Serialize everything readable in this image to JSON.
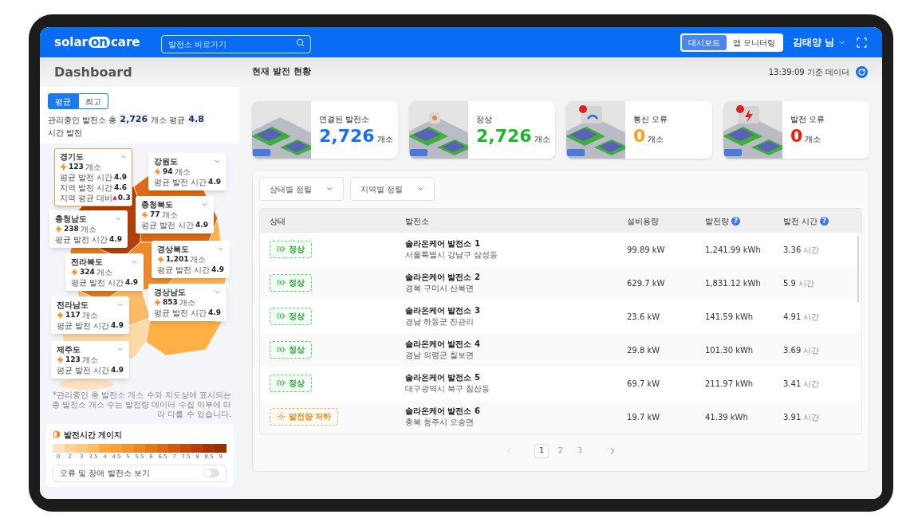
{
  "header": {
    "logo": [
      "solar",
      "on",
      "care"
    ],
    "search": {
      "placeholder": "발전소 바로가기"
    },
    "view_tabs": [
      {
        "label": "대시보드",
        "selected": true
      },
      {
        "label": "앱 모니터링",
        "selected": false
      }
    ],
    "user": "김태양 님"
  },
  "subheader": {
    "title": "Dashboard",
    "section": "현재 발전 현황",
    "timestamp": "13:39:09 기준 데이터"
  },
  "sidebar": {
    "mode_tabs": [
      {
        "label": "평균",
        "selected": true
      },
      {
        "label": "최고",
        "selected": false
      }
    ],
    "summary": [
      {
        "kind": "label",
        "text": "관리중인 발전소 총"
      },
      {
        "kind": "value",
        "text": "2,726"
      },
      {
        "kind": "label",
        "text": "개소 평균"
      },
      {
        "kind": "value",
        "text": "4.8"
      },
      {
        "kind": "label",
        "text": "시간 발전"
      }
    ],
    "regions": [
      {
        "name": "경기도",
        "expanded": true,
        "count": "123",
        "unit": "개소",
        "rows": [
          {
            "label": "평균 발전 시간",
            "value": "4.9"
          },
          {
            "label": "지역 발전 시간",
            "value": "4.6"
          },
          {
            "label": "지역 평균 대비",
            "value": "0.3",
            "marker": "▲"
          }
        ]
      },
      {
        "name": "강원도",
        "expanded": false,
        "count": "94",
        "unit": "개소",
        "rows": [
          {
            "label": "평균 발전 시간",
            "value": "4.9"
          }
        ]
      },
      {
        "name": "충청북도",
        "expanded": false,
        "count": "77",
        "unit": "개소",
        "rows": [
          {
            "label": "평균 발전 시간",
            "value": "4.9"
          }
        ]
      },
      {
        "name": "충청남도",
        "expanded": false,
        "count": "238",
        "unit": "개소",
        "rows": [
          {
            "label": "평균 발전 시간",
            "value": "4.9"
          }
        ]
      },
      {
        "name": "경상북도",
        "expanded": false,
        "count": "1,201",
        "unit": "개소",
        "rows": [
          {
            "label": "평균 발전 시간",
            "value": "4.9"
          }
        ]
      },
      {
        "name": "전라북도",
        "expanded": false,
        "count": "324",
        "unit": "개소",
        "rows": [
          {
            "label": "평균 발전 시간",
            "value": "4.9"
          }
        ]
      },
      {
        "name": "경상남도",
        "expanded": false,
        "count": "853",
        "unit": "개소",
        "rows": [
          {
            "label": "평균 발전 시간",
            "value": "4.9"
          }
        ]
      },
      {
        "name": "전라남도",
        "expanded": false,
        "count": "117",
        "unit": "개소",
        "rows": [
          {
            "label": "평균 발전 시간",
            "value": "4.9"
          }
        ]
      },
      {
        "name": "제주도",
        "expanded": false,
        "count": "123",
        "unit": "개소",
        "rows": [
          {
            "label": "평균 발전 시간",
            "value": "4.9"
          }
        ]
      }
    ],
    "note": "*관리중인 총 발전소 개소 수와 지도상에 표시되는 총 발전소 개소 수는 발전량 데이터 수집 여부에 따라 다를 수 있습니다.",
    "gauge": {
      "title": "발전시간 게이지",
      "steps": [
        {
          "label": "0",
          "color": "#fde2c0"
        },
        {
          "label": "2",
          "color": "#fcd3a0"
        },
        {
          "label": "3",
          "color": "#fdc888"
        },
        {
          "label": "3.5",
          "color": "#fdbb66"
        },
        {
          "label": "4",
          "color": "#fda838"
        },
        {
          "label": "4.5",
          "color": "#f8a03a"
        },
        {
          "label": "5",
          "color": "#f39430"
        },
        {
          "label": "5.5",
          "color": "#ed8626"
        },
        {
          "label": "6",
          "color": "#e6781c"
        },
        {
          "label": "6.5",
          "color": "#de6a14"
        },
        {
          "label": "7",
          "color": "#d2590f"
        },
        {
          "label": "7.5",
          "color": "#c44a0a"
        },
        {
          "label": "8",
          "color": "#b83d08"
        },
        {
          "label": "8.5",
          "color": "#a83406"
        },
        {
          "label": "9",
          "color": "#983004"
        }
      ]
    },
    "error_toggle": {
      "label": "오류 및 장애 발전소 보기",
      "on": false
    }
  },
  "cards": [
    {
      "label": "연결된 발전소",
      "value": "2,726",
      "unit": "개소",
      "color": "#1a6ef5"
    },
    {
      "label": "정상",
      "value": "2,726",
      "unit": "개소",
      "color": "#1db82a"
    },
    {
      "label": "통신 오류",
      "value": "0",
      "unit": "개소",
      "color": "#f9a21b"
    },
    {
      "label": "발전 오류",
      "value": "0",
      "unit": "개소",
      "color": "#f51b0c"
    }
  ],
  "filters": [
    "상태별 정렬",
    "지역별 정렬"
  ],
  "table": {
    "columns": [
      {
        "label": "상태"
      },
      {
        "label": "발전소"
      },
      {
        "label": "설비용량"
      },
      {
        "label": "발전량",
        "help": "?"
      },
      {
        "label": "발전 시간",
        "help": "?"
      }
    ],
    "rows": [
      {
        "status": {
          "kind": "normal",
          "label": "정상"
        },
        "name": "솔라온케어 발전소 1",
        "address": "서울특별시 강남구 삼성동",
        "capacity": "99.89 kW",
        "output": "1,241.99 kWh",
        "hours": "3.36",
        "hours_unit": "시간"
      },
      {
        "status": {
          "kind": "normal",
          "label": "정상"
        },
        "name": "솔라온케어 발전소 2",
        "address": "경북 구미시 산북면",
        "capacity": "629.7 kW",
        "output": "1,831.12 kWh",
        "hours": "5.9",
        "hours_unit": "시간"
      },
      {
        "status": {
          "kind": "normal",
          "label": "정상"
        },
        "name": "솔라온케어 발전소 3",
        "address": "경남 하동군 진관리",
        "capacity": "23.6 kW",
        "output": "141.59 kWh",
        "hours": "4.91",
        "hours_unit": "시간"
      },
      {
        "status": {
          "kind": "normal",
          "label": "정상"
        },
        "name": "솔라온케어 발전소 4",
        "address": "경남 의령군 칠보면",
        "capacity": "29.8 kW",
        "output": "101.30 kWh",
        "hours": "3.69",
        "hours_unit": "시간"
      },
      {
        "status": {
          "kind": "normal",
          "label": "정상"
        },
        "name": "솔라온케어 발전소 5",
        "address": "대구광역시 북구 침산동",
        "capacity": "69.7 kW",
        "output": "211.97 kWh",
        "hours": "3.41",
        "hours_unit": "시간"
      },
      {
        "status": {
          "kind": "low",
          "label": "발전량 저하"
        },
        "name": "솔라온케어 발전소 6",
        "address": "충북 청주시 오송면",
        "capacity": "19.7 kW",
        "output": "41.39 kWh",
        "hours": "3.91",
        "hours_unit": "시간"
      }
    ]
  },
  "pagination": {
    "prev_disabled": true,
    "pages": [
      {
        "label": "1",
        "selected": true
      },
      {
        "label": "2",
        "selected": false
      },
      {
        "label": "3",
        "selected": false
      }
    ]
  }
}
